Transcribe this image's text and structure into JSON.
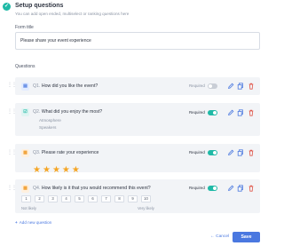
{
  "header": {
    "title": "Setup questions",
    "subtitle": "You can add open ended, multiselect or ranking questions here"
  },
  "form_title": {
    "label": "Form title",
    "value": "Please share your event experience"
  },
  "questions_label": "Questions",
  "questions": [
    {
      "number": "Q1.",
      "text": "How did you like the event?",
      "required_label": "Required",
      "required": false,
      "icon": "chat-icon"
    },
    {
      "number": "Q2.",
      "text": "What did you enjoy the most?",
      "required_label": "Required",
      "required": true,
      "icon": "checkbox-list-icon",
      "options": [
        "Atmosphere",
        "Speakers"
      ]
    },
    {
      "number": "Q3.",
      "text": "Please rate your experience",
      "required_label": "Required",
      "required": true,
      "icon": "rating-icon",
      "stars": 5
    },
    {
      "number": "Q4.",
      "text": "How likely is it that you would recommend this event?",
      "required_label": "Required",
      "required": true,
      "icon": "scale-icon",
      "scale": [
        "1",
        "2",
        "3",
        "4",
        "5",
        "6",
        "7",
        "8",
        "9",
        "10"
      ],
      "scale_min_label": "Not likely",
      "scale_max_label": "Very likely"
    }
  ],
  "add_question_label": "Add new question",
  "add_question_plus": "+",
  "footer": {
    "cancel_label": "Cancel",
    "cancel_arrow": "←",
    "save_label": "Save"
  },
  "colors": {
    "accent_teal": "#1fb9a6",
    "accent_blue": "#4a78e0",
    "star": "#f5a524",
    "delete_red": "#e0564a"
  },
  "icons": {
    "header_check": "✓",
    "drag": "⋮⋮",
    "star": "★"
  }
}
